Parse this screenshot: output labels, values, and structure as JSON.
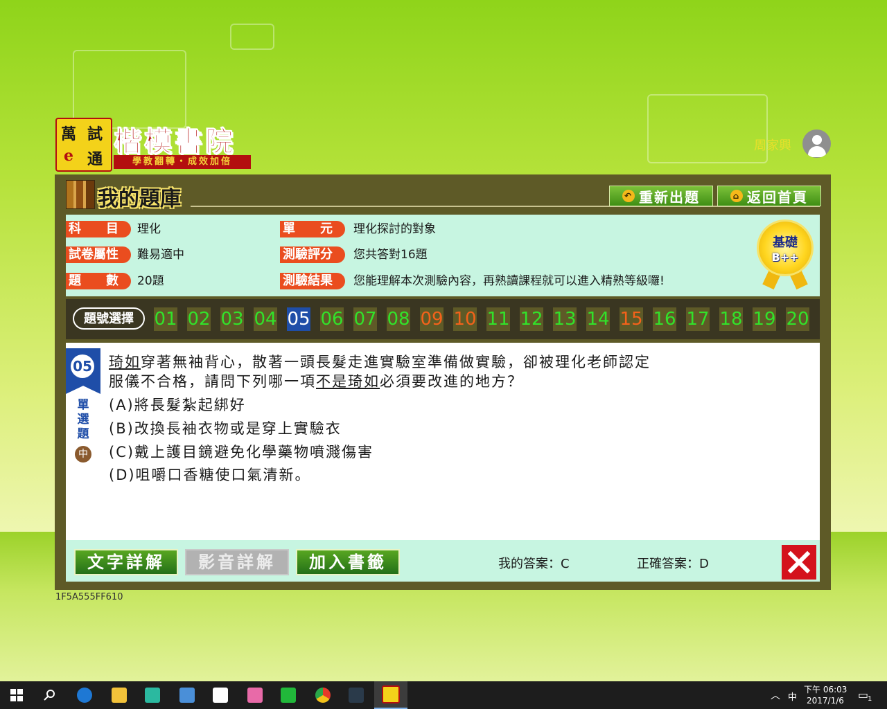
{
  "logo": {
    "badge": [
      "萬",
      "試",
      "e",
      "通"
    ],
    "title": "楷模書院",
    "subtitle": "學教翻轉・成效加倍"
  },
  "user": {
    "name": "周家興"
  },
  "header": {
    "title": "我的題庫",
    "retest_label": "重新出題",
    "home_label": "返回首頁"
  },
  "info": {
    "subject_label": "科　　目",
    "subject": "理化",
    "unit_label": "單　　元",
    "unit": "理化探討的對象",
    "attr_label": "試卷屬性",
    "attr": "難易適中",
    "score_label": "測驗評分",
    "score": "您共答對16題",
    "count_label": "題　　數",
    "count": "20題",
    "result_label": "測驗結果",
    "result": "您能理解本次測驗內容，再熟讀課程就可以進入精熟等級囉!",
    "medal_line1": "基礎",
    "medal_line2": "B++"
  },
  "qnav": {
    "select_label": "題號選擇",
    "items": [
      {
        "n": "01",
        "state": "correct"
      },
      {
        "n": "02",
        "state": "correct"
      },
      {
        "n": "03",
        "state": "correct"
      },
      {
        "n": "04",
        "state": "correct"
      },
      {
        "n": "05",
        "state": "current"
      },
      {
        "n": "06",
        "state": "correct"
      },
      {
        "n": "07",
        "state": "correct"
      },
      {
        "n": "08",
        "state": "correct"
      },
      {
        "n": "09",
        "state": "wrong"
      },
      {
        "n": "10",
        "state": "wrong"
      },
      {
        "n": "11",
        "state": "correct"
      },
      {
        "n": "12",
        "state": "correct"
      },
      {
        "n": "13",
        "state": "correct"
      },
      {
        "n": "14",
        "state": "correct"
      },
      {
        "n": "15",
        "state": "wrong"
      },
      {
        "n": "16",
        "state": "correct"
      },
      {
        "n": "17",
        "state": "correct"
      },
      {
        "n": "18",
        "state": "correct"
      },
      {
        "n": "19",
        "state": "correct"
      },
      {
        "n": "20",
        "state": "correct"
      }
    ]
  },
  "question": {
    "number": "05",
    "type": "單選題",
    "level": "中",
    "line1_a": "琦如",
    "line1_b": "穿著無袖背心，散著一頭長髮走進實驗室準備做實驗，卻被理化老師認定",
    "line2_a": "服儀不合格，請問下列哪一項",
    "line2_b": "不是",
    "line2_c": "琦如",
    "line2_d": "必須要改進的地方？",
    "options": [
      "(A)將長髮紮起綁好",
      "(B)改換長袖衣物或是穿上實驗衣",
      "(C)戴上護目鏡避免化學藥物噴濺傷害",
      "(D)咀嚼口香糖使口氣清新。"
    ]
  },
  "footer": {
    "text_explain": "文字詳解",
    "video_explain": "影音詳解",
    "bookmark": "加入書籤",
    "my_answer": "我的答案：C",
    "correct_answer": "正確答案：D"
  },
  "code": "1F5A555FF610",
  "taskbar": {
    "time": "下午 06:03",
    "date": "2017/1/6",
    "ime": "中",
    "notif": "1"
  },
  "colors": {
    "correct": "#32e22a",
    "wrong": "#f4621a",
    "current_bg": "#1f4ea8",
    "panel": "#5e5a27",
    "info_bg": "#c7f5e1"
  }
}
